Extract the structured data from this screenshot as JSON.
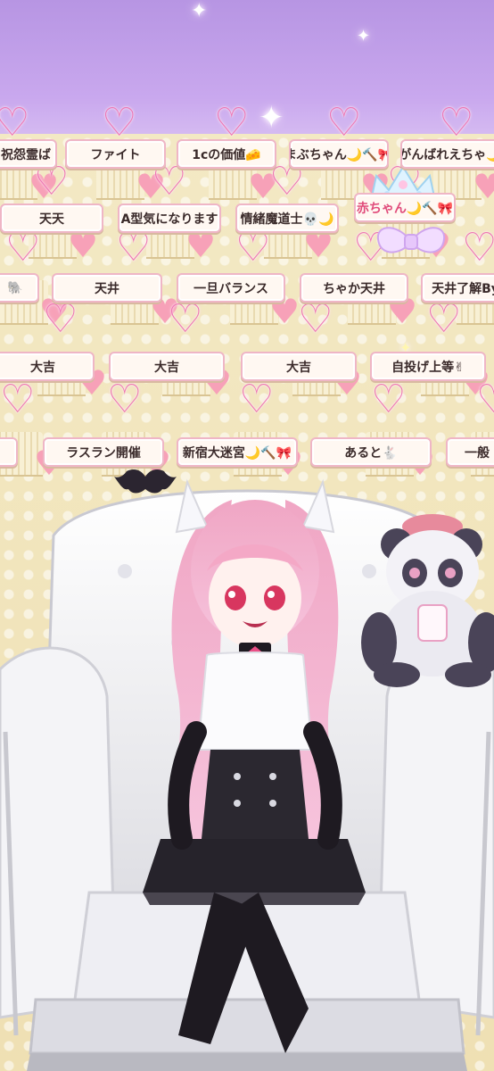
{
  "scene": {
    "type": "vtuber-stream-scene",
    "background_colors": {
      "sky": "#c4a2ec",
      "wall": "#f2e6c2",
      "heart": "#ee74b2",
      "plate_border": "#efb6c6"
    }
  },
  "nameplates": [
    {
      "text": "祝怨霊ば"
    },
    {
      "text": "ファイト"
    },
    {
      "text": "1cの価値🧀"
    },
    {
      "text": "まぶちゃん🌙🔨🎀"
    },
    {
      "text": "がんばれえちゃ🌙"
    },
    {
      "text": "天天"
    },
    {
      "text": "A型気になります"
    },
    {
      "text": "情緒魔道士💀🌙"
    },
    {
      "text": "赤ちゃん🌙🔨🎀"
    },
    {
      "text": "🐘"
    },
    {
      "text": "天井"
    },
    {
      "text": "一旦バランス"
    },
    {
      "text": "ちゃか天井"
    },
    {
      "text": "天井了解By"
    },
    {
      "text": "大吉"
    },
    {
      "text": "大吉"
    },
    {
      "text": "大吉"
    },
    {
      "text": "自投げ上等✌"
    },
    {
      "text": "ラスラン開催"
    },
    {
      "text": "新宿大迷宮🌙🔨🎀"
    },
    {
      "text": "あると🐇"
    },
    {
      "text": "一般"
    }
  ],
  "decor": {
    "bats": [
      "bat-icon",
      "bat-icon",
      "bat-icon"
    ],
    "tiara": "tiara-icon",
    "plush": "panda-plush"
  }
}
